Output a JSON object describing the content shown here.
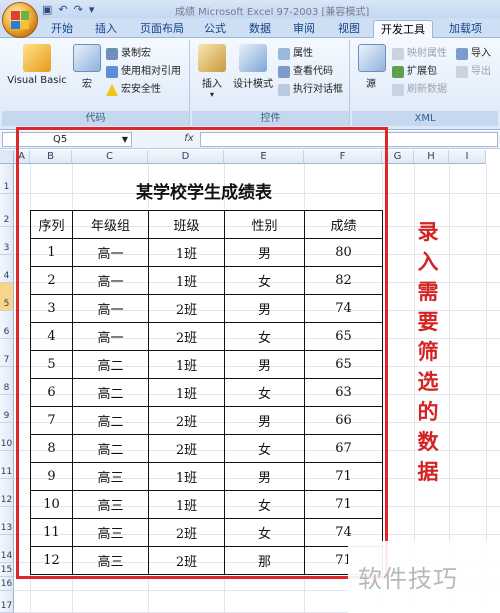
{
  "window": {
    "title": "成绩 Microsoft Excel 97-2003 [兼容模式]"
  },
  "ribbon": {
    "tabs": [
      "开始",
      "插入",
      "页面布局",
      "公式",
      "数据",
      "审阅",
      "视图",
      "开发工具",
      "加载项"
    ],
    "active_tab": "开发工具",
    "groups": {
      "code": {
        "label": "代码",
        "visual_basic": "Visual Basic",
        "macros": "宏",
        "record_macro": "录制宏",
        "relative_ref": "使用相对引用",
        "macro_security": "宏安全性"
      },
      "controls": {
        "label": "控件",
        "insert": "插入",
        "design_mode": "设计模式",
        "properties": "属性",
        "view_code": "查看代码",
        "run_dialog": "执行对话框"
      },
      "xml": {
        "label": "XML",
        "source": "源",
        "map_props": "映射属性",
        "expansion": "扩展包",
        "refresh": "刷新数据",
        "import": "导入",
        "export": "导出"
      }
    }
  },
  "formula_bar": {
    "name_box": "Q5",
    "fx": "fx",
    "formula": ""
  },
  "columns": [
    "A",
    "B",
    "C",
    "D",
    "E",
    "F",
    "G",
    "H",
    "I"
  ],
  "rows": [
    "1",
    "2",
    "3",
    "4",
    "5",
    "6",
    "7",
    "8",
    "9",
    "10",
    "11",
    "12",
    "13",
    "14",
    "15",
    "16",
    "17"
  ],
  "selected_row": "5",
  "sheet": {
    "title": "某学校学生成绩表",
    "headers": [
      "序列",
      "年级组",
      "班级",
      "性别",
      "成绩"
    ],
    "records": [
      [
        "1",
        "高一",
        "1班",
        "男",
        "80"
      ],
      [
        "2",
        "高一",
        "1班",
        "女",
        "82"
      ],
      [
        "3",
        "高一",
        "2班",
        "男",
        "74"
      ],
      [
        "4",
        "高一",
        "2班",
        "女",
        "65"
      ],
      [
        "5",
        "高二",
        "1班",
        "男",
        "65"
      ],
      [
        "6",
        "高二",
        "1班",
        "女",
        "63"
      ],
      [
        "7",
        "高二",
        "2班",
        "男",
        "66"
      ],
      [
        "8",
        "高二",
        "2班",
        "女",
        "67"
      ],
      [
        "9",
        "高三",
        "1班",
        "男",
        "71"
      ],
      [
        "10",
        "高三",
        "1班",
        "女",
        "71"
      ],
      [
        "11",
        "高三",
        "2班",
        "女",
        "74"
      ],
      [
        "12",
        "高三",
        "2班",
        "那",
        "71"
      ]
    ]
  },
  "annotation": {
    "text": "录入需要筛选的数据",
    "color": "#d32323"
  },
  "watermark": "软件技巧",
  "colors": {
    "frame": "#e0252b",
    "ribbon_bg": "#dbe8f8",
    "tab_text": "#15428b"
  }
}
